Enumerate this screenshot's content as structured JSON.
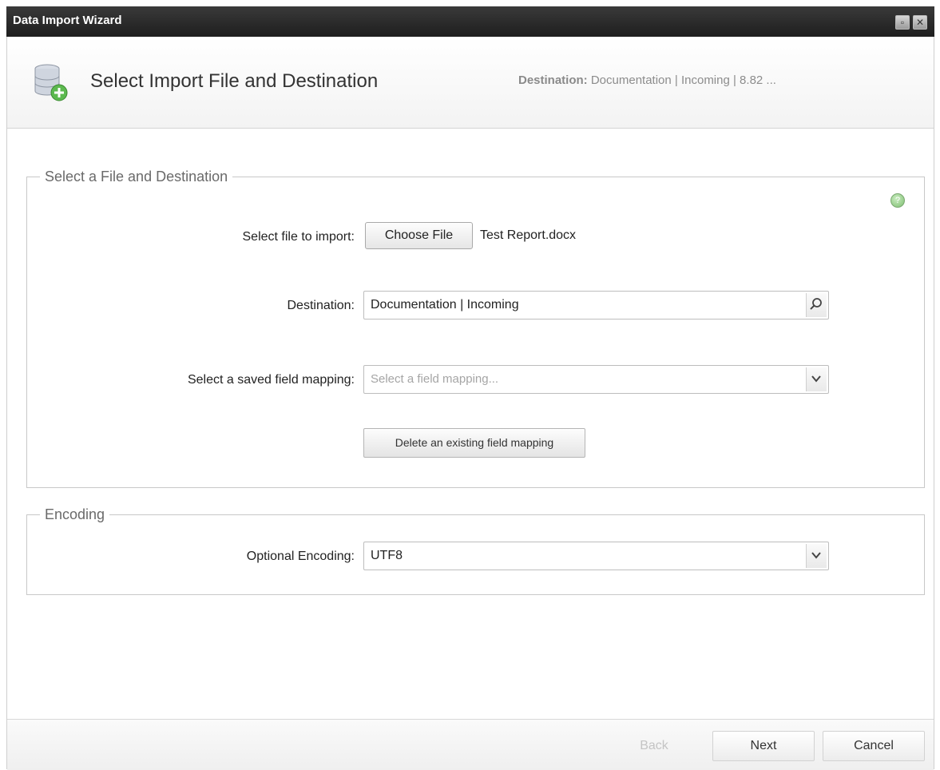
{
  "window": {
    "title": "Data Import Wizard"
  },
  "header": {
    "title": "Select Import File and Destination",
    "destination_label": "Destination:",
    "destination_value": " Documentation | Incoming | 8.82 ..."
  },
  "file_section": {
    "legend": "Select a File and Destination",
    "file_label": "Select file to import:",
    "choose_file_label": "Choose File",
    "file_name": "Test Report.docx",
    "destination_label": "Destination:",
    "destination_value": "Documentation | Incoming",
    "mapping_label": "Select a saved field mapping:",
    "mapping_placeholder": "Select a field mapping...",
    "delete_mapping_label": "Delete an existing field mapping"
  },
  "encoding_section": {
    "legend": "Encoding",
    "encoding_label": "Optional Encoding:",
    "encoding_value": "UTF8"
  },
  "footer": {
    "back_label": "Back",
    "next_label": "Next",
    "cancel_label": "Cancel"
  },
  "icons": {
    "header": "database-add-icon",
    "help": "help-icon",
    "search": "search-icon",
    "dropdown": "chevron-down-icon"
  }
}
